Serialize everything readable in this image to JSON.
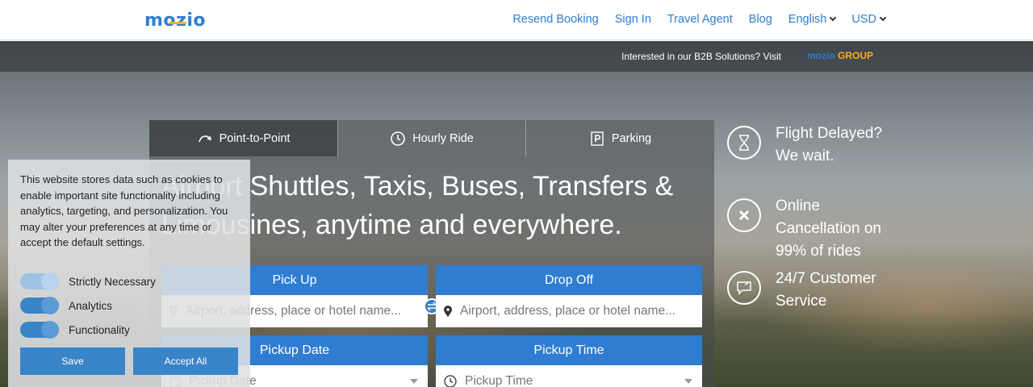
{
  "header": {
    "logo": "mozio",
    "nav": [
      "Resend Booking",
      "Sign In",
      "Travel Agent",
      "Blog"
    ],
    "language": "English",
    "currency": "USD"
  },
  "b2b": {
    "text": "Interested in our B2B Solutions? Visit",
    "logo_main": "mozio",
    "logo_group": "GROUP"
  },
  "tabs": [
    {
      "label": "Point-to-Point",
      "icon": "curve-arrow-icon"
    },
    {
      "label": "Hourly Ride",
      "icon": "clock-icon"
    },
    {
      "label": "Parking",
      "icon": "parking-icon"
    }
  ],
  "headline": "Airport Shuttles, Taxis, Buses, Transfers & Limousines, anytime and everywhere.",
  "form": {
    "pickup_label": "Pick Up",
    "pickup_placeholder": "Airport, address, place or hotel name...",
    "dropoff_label": "Drop Off",
    "dropoff_placeholder": "Airport, address, place or hotel name...",
    "date_label": "Pickup Date",
    "date_placeholder": "Pickup Date",
    "time_label": "Pickup Time",
    "time_placeholder": "Pickup Time"
  },
  "features": [
    {
      "text": "Flight Delayed? We wait.",
      "icon": "hourglass-icon"
    },
    {
      "text": "Online Cancellation on 99% of rides",
      "icon": "close-icon"
    },
    {
      "text": "24/7 Customer Service",
      "icon": "chat-icon"
    }
  ],
  "cookie": {
    "text": "This website stores data such as cookies to enable important site functionality including analytics, targeting, and personalization. You may alter your preferences at any time or accept the default settings.",
    "options": [
      {
        "label": "Strictly Necessary",
        "on": true
      },
      {
        "label": "Analytics",
        "on": true
      },
      {
        "label": "Functionality",
        "on": true
      }
    ],
    "save": "Save",
    "accept": "Accept All"
  },
  "colors": {
    "brand_blue": "#2f7dd1",
    "brand_yellow": "#f6b21b"
  }
}
